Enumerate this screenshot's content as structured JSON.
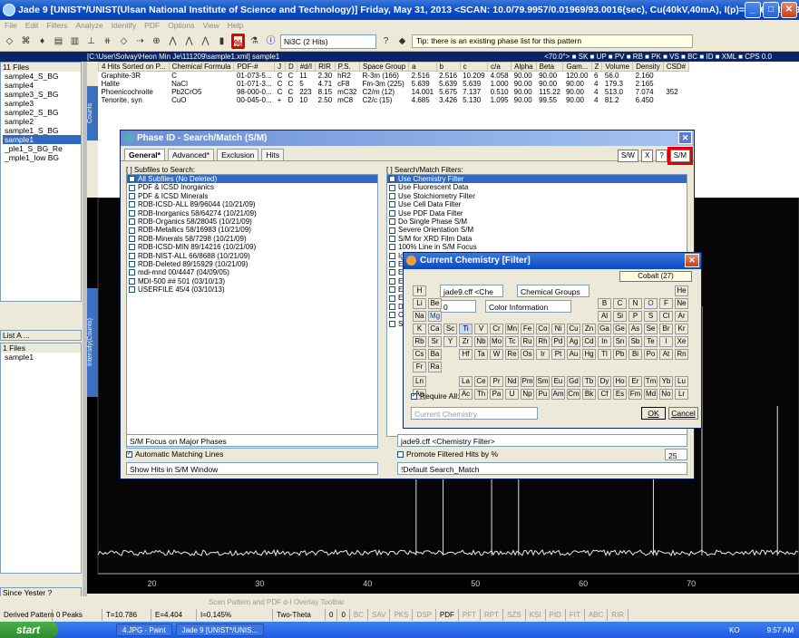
{
  "window": {
    "title": "Jade 9 [UNIST*/UNIST(Ulsan National Institute of Science and Technology)] Friday, May 31, 2013 <SCAN: 10.0/79.9957/0.01969/93.0016(sec), Cu(40kV,40mA), I(p)=20961, 12/09/11 02:..."
  },
  "menu": [
    "File",
    "Edit",
    "Filters",
    "Analyze",
    "Identify",
    "PDF",
    "Options",
    "View",
    "Help"
  ],
  "toolbar": {
    "hits_dropdown": "Ni3C (2 Hits)",
    "tip": "Tip: there is an existing phase list for this pattern"
  },
  "path": "[C:\\User\\Solvay\\Heon Min Je\\111209\\sample1.xml] sample1",
  "filterbar": {
    "range": "<70.0°>",
    "flags": [
      "SK",
      "UP",
      "PV",
      "RB",
      "PK",
      "VS",
      "BC",
      "ID",
      "XML",
      "CPS"
    ],
    "value": "0.0"
  },
  "left_panel": {
    "files_header": "11 Files",
    "files": [
      "sample4_S_BG",
      "sample4",
      "sample3_S_BG",
      "sample3",
      "sample2_S_BG",
      "sample2",
      "sample1_S_BG",
      "sample1",
      "_ple1_S_BG_Re",
      "_mple1_low BG"
    ],
    "list_label": "List A ...",
    "files2_header": "1 Files",
    "files2": [
      "sample1"
    ],
    "bottom_label": "Since Yester ?"
  },
  "hits": {
    "headers": [
      "4 Hits Sorted on P...",
      "Chemical Formula",
      "PDF-#",
      "J",
      "D",
      "#d/I",
      "RIR",
      "P.S.",
      "Space Group",
      "a",
      "b",
      "c",
      "c/a",
      "Alpha",
      "Beta",
      "Gam...",
      "Z",
      "Volume",
      "Density",
      "CSD#"
    ],
    "rows": [
      [
        "Graphite-3R",
        "C",
        "01-073-5...",
        "C",
        "C",
        "11",
        "2.30",
        "hR2",
        "R-3m (166)",
        "2.516",
        "2.516",
        "10.209",
        "4.058",
        "90.00",
        "90.00",
        "120.00",
        "6",
        "56.0",
        "2.160",
        ""
      ],
      [
        "Halite",
        "NaCl",
        "01-071-3...",
        "C",
        "C",
        "5",
        "4.71",
        "cF8",
        "Fm-3m (225)",
        "5.639",
        "5.639",
        "5.639",
        "1.000",
        "90.00",
        "90.00",
        "90.00",
        "4",
        "179.3",
        "2.165",
        ""
      ],
      [
        "Phoenicochroite",
        "Pb2CrO5",
        "98-000-0...",
        "C",
        "C",
        "223",
        "8.15",
        "mC32",
        "C2/m (12)",
        "14.001",
        "5.675",
        "7.137",
        "0.510",
        "90.00",
        "115.22",
        "90.00",
        "4",
        "513.0",
        "7.074",
        "352"
      ],
      [
        "Tenorite, syn",
        "CuO",
        "00-045-0...",
        "+",
        "D",
        "10",
        "2.50",
        "mC8",
        "C2/c (15)",
        "4.685",
        "3.426",
        "5.130",
        "1.095",
        "90.00",
        "99.55",
        "90.00",
        "4",
        "81.2",
        "6.450",
        ""
      ]
    ]
  },
  "counts_label": "Counts",
  "intensity_label": "Intensity(Counts)",
  "dialog": {
    "title": "Phase ID - Search/Match (S/M)",
    "tabs": [
      "General*",
      "Advanced*",
      "Exclusion",
      "Hits"
    ],
    "subfiles_label": "[ ] Subfiles to Search:",
    "subfiles": [
      "All Subfiles (No Deleted)",
      "PDF & ICSD Inorganics",
      "PDF & ICSD Minerals",
      "RDB-ICSD-ALL  89/96044 (10/21/09)",
      "RDB-Inorganics  58/64274 (10/21/09)",
      "RDB-Organics  58/28045 (10/21/09)",
      "RDB-Metallics  58/16983 (10/21/09)",
      "RDB-Minerals  58/7298 (10/21/09)",
      "RDB-ICSD-MIN  89/14216 (10/21/09)",
      "RDB-NIST-ALL  66/8688 (10/21/09)",
      "RDB-Deleted  89/15929 (10/21/09)",
      "mdi-mnd  00/4447 (04/09/05)",
      "MDI-500  ## 501 (03/10/13)",
      "USERFILE  45/4 (03/10/13)"
    ],
    "filters_label": "[ ] Search/Match Filters:",
    "filters": [
      "Use Chemistry Filter",
      "Use Fluorescent Data",
      "Use Stoichiometry Filter",
      "Use Cell Data Filter",
      "Use PDF Data Filter",
      "Do Single Phase S/M",
      "Severe Orientation S/M",
      "S/M for XRD Film Data",
      "100% Line in S/M Focus",
      "Ig...",
      "Ex...",
      "Ex...",
      "Ex...",
      "Ex...",
      "Ex...",
      "De...",
      "Ch...",
      "Se..."
    ],
    "list_all": "List All Subfiles",
    "focus": "S/M Focus on Major Phases",
    "auto_lines": "Automatic Matching Lines",
    "show_hits": "Show Hits in S/M Window",
    "jade_filter": "jade9.cff <Chemistry Filter>",
    "promote": "Promote Filtered Hits by %",
    "promote_val": "25",
    "default_sm": "!Default Search_Match",
    "buttons": [
      "S/W",
      "X",
      "?",
      "S/M"
    ]
  },
  "chem": {
    "title": "Current Chemistry [Filter]",
    "cff": "jade9.cff <Che",
    "groups": "Chemical Groups",
    "element_label": "Cobalt (27)",
    "color_info": "Color Information",
    "num": "0",
    "require_all": "Require All:",
    "current_chem": "Current Chemistry",
    "ok": "OK",
    "cancel": "Cancel",
    "periods": [
      [
        "H",
        "",
        "",
        "",
        "",
        "",
        "",
        "",
        "",
        "",
        "",
        "",
        "",
        "",
        "",
        "",
        "",
        "He"
      ],
      [
        "Li",
        "Be",
        "",
        "",
        "",
        "",
        "",
        "",
        "",
        "",
        "",
        "",
        "B",
        "C",
        "N",
        "O",
        "F",
        "Ne"
      ],
      [
        "Na",
        "Mg",
        "",
        "",
        "",
        "",
        "",
        "",
        "",
        "",
        "",
        "",
        "Al",
        "Si",
        "P",
        "S",
        "Cl",
        "Ar"
      ],
      [
        "K",
        "Ca",
        "Sc",
        "Ti",
        "V",
        "Cr",
        "Mn",
        "Fe",
        "Co",
        "Ni",
        "Cu",
        "Zn",
        "Ga",
        "Ge",
        "As",
        "Se",
        "Br",
        "Kr"
      ],
      [
        "Rb",
        "Sr",
        "Y",
        "Zr",
        "Nb",
        "Mo",
        "Tc",
        "Ru",
        "Rh",
        "Pd",
        "Ag",
        "Cd",
        "In",
        "Sn",
        "Sb",
        "Te",
        "I",
        "Xe"
      ],
      [
        "Cs",
        "Ba",
        "",
        "Hf",
        "Ta",
        "W",
        "Re",
        "Os",
        "Ir",
        "Pt",
        "Au",
        "Hg",
        "Tl",
        "Pb",
        "Bi",
        "Po",
        "At",
        "Rn"
      ],
      [
        "Fr",
        "Ra",
        "",
        "",
        "",
        "",
        "",
        "",
        "",
        "",
        "",
        "",
        "",
        "",
        "",
        "",
        "",
        ""
      ]
    ],
    "lanthanides": [
      "La",
      "Ce",
      "Pr",
      "Nd",
      "Pm",
      "Sm",
      "Eu",
      "Gd",
      "Tb",
      "Dy",
      "Ho",
      "Er",
      "Tm",
      "Yb",
      "Lu"
    ],
    "actinides": [
      "Ac",
      "Th",
      "Pa",
      "U",
      "Np",
      "Pu",
      "Am",
      "Cm",
      "Bk",
      "Cf",
      "Es",
      "Fm",
      "Md",
      "No",
      "Lr"
    ],
    "lan_label": "Ln",
    "act_label": "An"
  },
  "chart": {
    "ticks": [
      "20",
      "30",
      "40",
      "50",
      "60",
      "70"
    ]
  },
  "bottom_toolbar": "Scan Pattern and PDF d-I Overlay Toolbar",
  "status": {
    "derived": "Derived Pattern",
    "peaks": "0 Peaks",
    "t": "T=10.786",
    "e": "E=4.404",
    "i": "I=0.145%",
    "twotheta": "Two-Theta",
    "v1": "0",
    "v2": "0",
    "flags": [
      "BC",
      "SAV",
      "PKS",
      "DSP",
      "PDF",
      "PFT",
      "RPT",
      "SZS",
      "KSI",
      "PID",
      "FIT",
      "ABC",
      "RIR"
    ]
  },
  "taskbar": {
    "start": "start",
    "tasks": [
      "4.JPG - Paint",
      "Jade 9 [UNIST*/UNIS..."
    ],
    "lang": "KO",
    "time": "9:57 AM"
  }
}
